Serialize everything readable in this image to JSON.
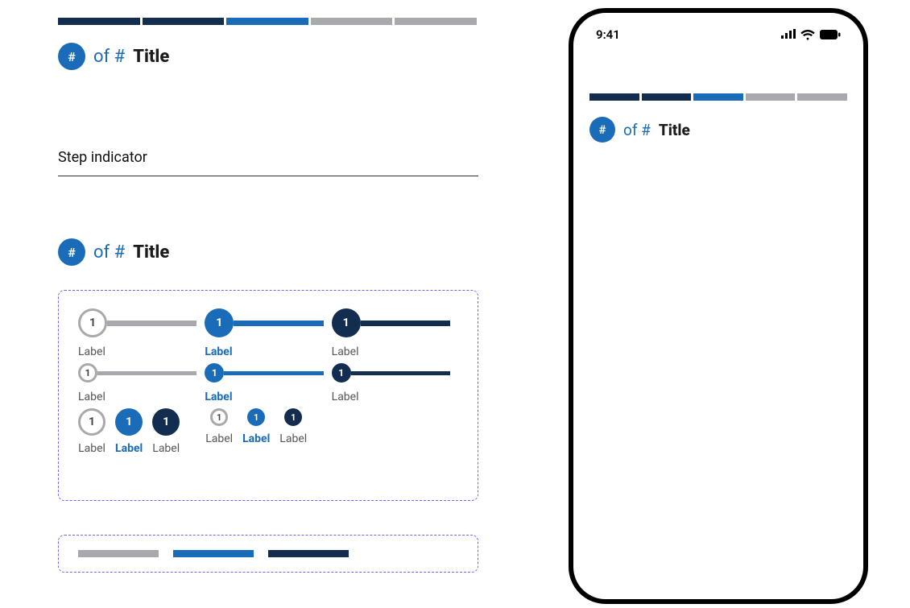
{
  "segments": {
    "colors": [
      "dark",
      "dark",
      "blue",
      "grey",
      "grey"
    ]
  },
  "step_title": {
    "current": "#",
    "of_label": "of #",
    "title": "Title"
  },
  "section_heading": "Step indicator",
  "dots": {
    "row_lg": [
      {
        "num": "1",
        "label": "Label",
        "state": "inactive",
        "connector": "grey"
      },
      {
        "num": "1",
        "label": "Label",
        "state": "blue",
        "connector": "blue"
      },
      {
        "num": "1",
        "label": "Label",
        "state": "dark",
        "connector": "dark"
      }
    ],
    "row_sm": [
      {
        "num": "1",
        "label": "Label",
        "state": "inactive",
        "connector": "grey"
      },
      {
        "num": "1",
        "label": "Label",
        "state": "blue",
        "connector": "blue"
      },
      {
        "num": "1",
        "label": "Label",
        "state": "dark",
        "connector": "dark"
      }
    ],
    "circles_lg": [
      {
        "num": "1",
        "label": "Label",
        "state": "inactive"
      },
      {
        "num": "1",
        "label": "Label",
        "state": "blue"
      },
      {
        "num": "1",
        "label": "Label",
        "state": "dark"
      }
    ],
    "circles_sm": [
      {
        "num": "1",
        "label": "Label",
        "state": "inactive"
      },
      {
        "num": "1",
        "label": "Label",
        "state": "blue"
      },
      {
        "num": "1",
        "label": "Label",
        "state": "dark"
      }
    ]
  },
  "segments_row": {
    "colors": [
      "grey",
      "blue",
      "dark"
    ]
  },
  "phone": {
    "time": "9:41",
    "segments": [
      "dark",
      "dark",
      "blue",
      "grey",
      "grey"
    ],
    "step_title": {
      "current": "#",
      "of_label": "of #",
      "title": "Title"
    }
  }
}
